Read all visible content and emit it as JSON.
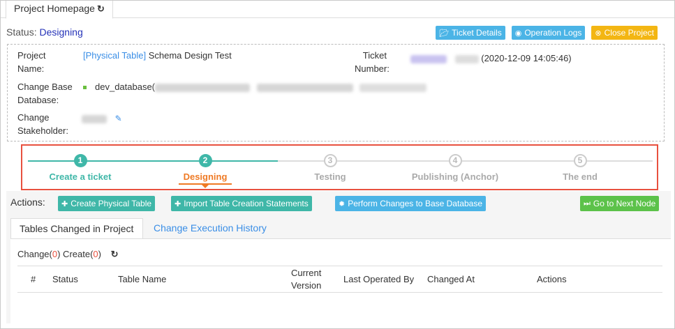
{
  "tab": {
    "title": "Project Homepage",
    "icon": "refresh-icon"
  },
  "status": {
    "label": "Status:",
    "value": "Designing"
  },
  "top_buttons": [
    {
      "label": "Ticket Details",
      "icon": "folder-open-icon",
      "color": "#4bb4e6"
    },
    {
      "label": "Operation Logs",
      "icon": "eye-icon",
      "color": "#4bb4e6"
    },
    {
      "label": "Close Project",
      "icon": "close-circle-icon",
      "color": "#f3b613"
    }
  ],
  "info": {
    "project_name_label_1": "Project",
    "project_name_label_2": "Name:",
    "project_name_tag": "[Physical Table]",
    "project_name_value": "Schema Design Test",
    "ticket_label_1": "Ticket",
    "ticket_label_2": "Number:",
    "ticket_date": "(2020-12-09 14:05:46)",
    "base_db_label_1": "Change Base",
    "base_db_label_2": "Database:",
    "base_db_value": "dev_database(",
    "stakeholder_label_1": "Change",
    "stakeholder_label_2": "Stakeholder:"
  },
  "steps": [
    {
      "num": "1",
      "label": "Create a ticket",
      "state": "done"
    },
    {
      "num": "2",
      "label": "Designing",
      "state": "current"
    },
    {
      "num": "3",
      "label": "Testing",
      "state": "todo"
    },
    {
      "num": "4",
      "label": "Publishing (Anchor)",
      "state": "todo"
    },
    {
      "num": "5",
      "label": "The end",
      "state": "todo"
    }
  ],
  "actions": {
    "label": "Actions:",
    "buttons": [
      {
        "label": "Create Physical Table",
        "icon": "plus-icon"
      },
      {
        "label": "Import Table Creation Statements",
        "icon": "plus-icon"
      },
      {
        "label": "Perform Changes to Base Database",
        "icon": "bug-icon"
      }
    ],
    "next": {
      "label": "Go to Next Node",
      "icon": "forward-icon"
    }
  },
  "content_tabs": [
    {
      "label": "Tables Changed in Project",
      "active": true
    },
    {
      "label": "Change Execution History",
      "active": false
    }
  ],
  "counts": {
    "change_label": "Change(",
    "change_n": "0",
    "create_label": ") Create(",
    "create_n": "0",
    "close": ")"
  },
  "table": {
    "columns": [
      "#",
      "Status",
      "Table Name",
      "Current",
      "Version",
      "Last Operated By",
      "Changed At",
      "Actions"
    ]
  }
}
